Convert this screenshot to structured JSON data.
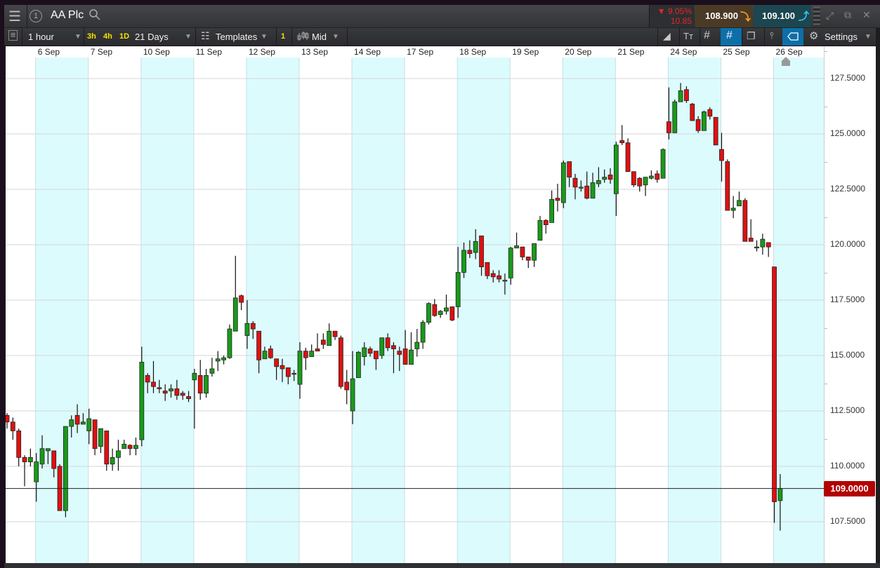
{
  "header": {
    "instrument_number": "1",
    "instrument_name": "AA Plc",
    "change_percent": "▼ 9.05%",
    "change_value": "10.85",
    "sell_price": "108.900",
    "buy_price": "109.100"
  },
  "toolbar": {
    "interval": "1 hour",
    "quick_intervals": [
      "3h",
      "4h",
      "1D"
    ],
    "range": "21 Days",
    "templates_label": "Templates",
    "chart_count": "1",
    "price_type": "Mid",
    "settings_label": "Settings"
  },
  "colors": {
    "up": "#1a9a1a",
    "down": "#e01010",
    "shade": "#dcfbfd",
    "sell_bg": "#4b3a26",
    "buy_bg": "#1c4650",
    "current_price_bg": "#b30000",
    "highlight": "#0d6fa8"
  },
  "chart_data": {
    "type": "candlestick",
    "dates": [
      "6 Sep",
      "7 Sep",
      "10 Sep",
      "11 Sep",
      "12 Sep",
      "13 Sep",
      "14 Sep",
      "17 Sep",
      "18 Sep",
      "19 Sep",
      "20 Sep",
      "21 Sep",
      "24 Sep",
      "25 Sep",
      "26 Sep"
    ],
    "day_start_index": [
      5,
      14,
      23,
      32,
      41,
      50,
      59,
      68,
      77,
      86,
      95,
      104,
      113,
      122,
      131
    ],
    "yticks": [
      "127.5000",
      "125.0000",
      "122.5000",
      "120.0000",
      "117.5000",
      "115.0000",
      "112.5000",
      "110.0000",
      "107.5000"
    ],
    "ytick_values": [
      127.5,
      125,
      122.5,
      120,
      117.5,
      115,
      112.5,
      110,
      107.5
    ],
    "current_price": 109.0,
    "current_price_label": "109.0000",
    "ohlc": [
      [
        112.3,
        112.4,
        111.7,
        112.0
      ],
      [
        112.0,
        112.2,
        111.2,
        111.6
      ],
      [
        111.6,
        111.7,
        110.0,
        110.4
      ],
      [
        110.4,
        110.5,
        109.1,
        110.2
      ],
      [
        110.2,
        110.8,
        110.0,
        110.4
      ],
      [
        109.3,
        110.6,
        108.4,
        110.2
      ],
      [
        110.1,
        111.4,
        109.9,
        110.8
      ],
      [
        110.7,
        110.8,
        110.1,
        110.8
      ],
      [
        110.7,
        110.7,
        109.5,
        109.9
      ],
      [
        110.0,
        110.1,
        108.0,
        108.0
      ],
      [
        108.0,
        111.8,
        107.7,
        111.8
      ],
      [
        111.8,
        112.3,
        111.3,
        112.1
      ],
      [
        112.3,
        112.8,
        111.5,
        111.9
      ],
      [
        111.9,
        112.4,
        111.9,
        112.0
      ],
      [
        111.6,
        112.6,
        111.0,
        112.15
      ],
      [
        112.1,
        112.1,
        110.5,
        110.8
      ],
      [
        110.9,
        111.7,
        110.6,
        111.7
      ],
      [
        111.6,
        111.6,
        109.8,
        110.1
      ],
      [
        110.1,
        110.8,
        109.8,
        110.4
      ],
      [
        110.4,
        111.2,
        109.8,
        110.7
      ],
      [
        110.8,
        111.2,
        110.8,
        111.0
      ],
      [
        110.95,
        111.0,
        110.5,
        110.8
      ],
      [
        110.8,
        111.3,
        110.5,
        110.95
      ],
      [
        111.2,
        115.4,
        110.9,
        114.7
      ],
      [
        114.1,
        114.2,
        113.3,
        113.8
      ],
      [
        113.8,
        114.75,
        113.3,
        113.6
      ],
      [
        113.55,
        113.9,
        113.3,
        113.5
      ],
      [
        113.4,
        113.7,
        112.95,
        113.3
      ],
      [
        113.4,
        113.7,
        113.1,
        113.5
      ],
      [
        113.5,
        113.9,
        113.0,
        113.2
      ],
      [
        113.3,
        113.4,
        113.0,
        113.2
      ],
      [
        113.15,
        113.4,
        112.9,
        113.05
      ],
      [
        113.9,
        114.4,
        111.7,
        114.2
      ],
      [
        114.1,
        114.8,
        113.0,
        113.3
      ],
      [
        113.3,
        114.4,
        113.1,
        114.1
      ],
      [
        114.2,
        114.9,
        114.05,
        114.4
      ],
      [
        114.75,
        115.2,
        114.3,
        114.85
      ],
      [
        114.8,
        115.0,
        114.6,
        114.9
      ],
      [
        114.9,
        116.4,
        114.85,
        116.2
      ],
      [
        116.1,
        119.5,
        116.1,
        117.6
      ],
      [
        117.7,
        117.75,
        117.05,
        117.4
      ],
      [
        115.9,
        117.5,
        115.3,
        116.45
      ],
      [
        116.45,
        116.55,
        115.75,
        116.2
      ],
      [
        116.1,
        116.1,
        114.2,
        114.8
      ],
      [
        114.85,
        115.4,
        114.85,
        115.2
      ],
      [
        115.3,
        115.45,
        114.85,
        114.9
      ],
      [
        114.85,
        114.85,
        113.9,
        114.5
      ],
      [
        114.55,
        114.85,
        113.8,
        114.4
      ],
      [
        114.45,
        114.45,
        113.7,
        114.05
      ],
      [
        114.2,
        114.35,
        113.85,
        114.2
      ],
      [
        113.7,
        115.6,
        113.05,
        115.2
      ],
      [
        115.2,
        115.35,
        114.35,
        114.9
      ],
      [
        114.95,
        115.5,
        114.95,
        115.2
      ],
      [
        115.3,
        116.0,
        115.2,
        115.2
      ],
      [
        115.7,
        116.0,
        115.3,
        115.5
      ],
      [
        115.45,
        116.45,
        115.45,
        116.1
      ],
      [
        116.1,
        116.1,
        115.7,
        115.85
      ],
      [
        115.8,
        115.9,
        113.5,
        113.6
      ],
      [
        113.8,
        114.35,
        112.8,
        113.45
      ],
      [
        112.5,
        115.2,
        111.9,
        113.95
      ],
      [
        114.0,
        115.2,
        114.0,
        115.15
      ],
      [
        114.95,
        115.6,
        114.55,
        115.35
      ],
      [
        115.3,
        115.4,
        114.95,
        115.1
      ],
      [
        115.2,
        115.2,
        114.35,
        114.85
      ],
      [
        115.0,
        115.8,
        114.85,
        115.8
      ],
      [
        115.8,
        116.0,
        115.2,
        115.35
      ],
      [
        115.45,
        115.6,
        114.2,
        115.3
      ],
      [
        115.2,
        115.4,
        114.3,
        115.05
      ],
      [
        115.3,
        116.15,
        114.6,
        114.6
      ],
      [
        114.6,
        116.05,
        114.6,
        115.25
      ],
      [
        115.3,
        116.2,
        114.95,
        115.6
      ],
      [
        115.6,
        116.6,
        115.3,
        116.5
      ],
      [
        116.5,
        117.4,
        116.4,
        117.35
      ],
      [
        117.3,
        117.55,
        116.75,
        116.8
      ],
      [
        116.85,
        117.05,
        116.7,
        117.0
      ],
      [
        117.0,
        117.75,
        116.85,
        117.15
      ],
      [
        117.2,
        117.2,
        116.55,
        116.6
      ],
      [
        117.2,
        119.9,
        116.7,
        118.75
      ],
      [
        118.75,
        120.1,
        118.5,
        119.75
      ],
      [
        119.75,
        120.2,
        119.4,
        119.6
      ],
      [
        119.65,
        120.7,
        119.35,
        120.15
      ],
      [
        120.4,
        120.4,
        118.6,
        119.0
      ],
      [
        119.2,
        119.2,
        118.45,
        118.6
      ],
      [
        118.7,
        118.85,
        118.3,
        118.55
      ],
      [
        118.6,
        118.85,
        118.3,
        118.45
      ],
      [
        118.4,
        118.7,
        117.75,
        118.4
      ],
      [
        118.5,
        119.9,
        118.2,
        119.85
      ],
      [
        119.85,
        120.55,
        119.85,
        119.95
      ],
      [
        119.9,
        119.9,
        119.3,
        119.45
      ],
      [
        119.45,
        119.45,
        118.95,
        119.3
      ],
      [
        119.3,
        120.05,
        119.0,
        120.05
      ],
      [
        120.2,
        121.3,
        120.2,
        121.1
      ],
      [
        121.1,
        121.15,
        120.5,
        120.9
      ],
      [
        121.0,
        122.45,
        121.0,
        122.05
      ],
      [
        122.1,
        122.75,
        121.5,
        122.0
      ],
      [
        121.9,
        123.8,
        121.65,
        123.7
      ],
      [
        123.75,
        123.75,
        122.6,
        123.05
      ],
      [
        123.0,
        123.2,
        122.05,
        122.6
      ],
      [
        122.6,
        122.9,
        122.4,
        122.6
      ],
      [
        122.65,
        123.3,
        122.05,
        122.1
      ],
      [
        122.1,
        123.25,
        122.1,
        122.8
      ],
      [
        122.75,
        123.5,
        122.6,
        122.9
      ],
      [
        122.95,
        123.4,
        122.8,
        123.05
      ],
      [
        123.15,
        123.45,
        122.75,
        122.95
      ],
      [
        122.3,
        124.65,
        121.3,
        124.5
      ],
      [
        124.7,
        125.4,
        124.5,
        124.6
      ],
      [
        124.6,
        124.8,
        123.3,
        123.3
      ],
      [
        123.3,
        123.3,
        122.6,
        122.7
      ],
      [
        123.0,
        123.05,
        122.4,
        122.65
      ],
      [
        122.7,
        123.05,
        122.2,
        123.05
      ],
      [
        123.0,
        123.35,
        122.95,
        123.1
      ],
      [
        123.2,
        123.35,
        122.8,
        122.95
      ],
      [
        123.0,
        124.35,
        123.0,
        124.3
      ],
      [
        125.55,
        127.1,
        124.75,
        125.05
      ],
      [
        125.05,
        126.55,
        125.05,
        126.45
      ],
      [
        126.45,
        127.3,
        126.45,
        126.95
      ],
      [
        127.0,
        127.15,
        126.4,
        126.5
      ],
      [
        126.35,
        126.4,
        125.6,
        125.6
      ],
      [
        125.65,
        125.8,
        125.05,
        125.15
      ],
      [
        125.15,
        126.05,
        125.15,
        126.0
      ],
      [
        126.1,
        126.2,
        125.65,
        125.8
      ],
      [
        125.75,
        125.75,
        124.5,
        124.5
      ],
      [
        124.3,
        125.05,
        122.85,
        123.8
      ],
      [
        123.75,
        123.85,
        121.55,
        121.55
      ],
      [
        121.55,
        122.2,
        121.2,
        121.65
      ],
      [
        121.75,
        122.4,
        121.75,
        122.0
      ],
      [
        122.0,
        122.1,
        120.15,
        120.15
      ],
      [
        120.3,
        121.15,
        120.15,
        120.15
      ],
      [
        119.9,
        120.2,
        119.7,
        119.9
      ],
      [
        119.9,
        120.5,
        119.55,
        120.25
      ],
      [
        120.1,
        120.1,
        119.45,
        119.9
      ],
      [
        119.0,
        119.0,
        107.45,
        108.4
      ],
      [
        108.45,
        109.65,
        107.1,
        109.0
      ]
    ]
  }
}
